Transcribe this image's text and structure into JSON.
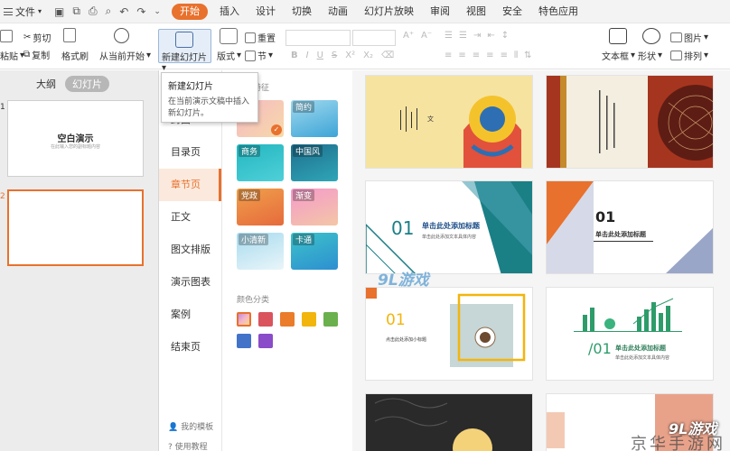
{
  "menubar": {
    "file_label": "文件",
    "tabs": [
      "开始",
      "插入",
      "设计",
      "切换",
      "动画",
      "幻灯片放映",
      "审阅",
      "视图",
      "安全",
      "特色应用"
    ],
    "active_tab": "开始"
  },
  "ribbon": {
    "paste": "粘贴",
    "cut": "剪切",
    "copy": "复制",
    "format_painter": "格式刷",
    "start_from_current": "从当前开始",
    "new_slide": "新建幻灯片",
    "layout": "版式",
    "reset": "重置",
    "section": "节",
    "textbox": "文本框",
    "shape": "形状",
    "picture": "图片",
    "arrange": "排列"
  },
  "tooltip": {
    "title": "新建幻灯片",
    "desc": "在当前演示文稿中插入新幻灯片。"
  },
  "left_panel": {
    "tabs": [
      "大纲",
      "幻灯片"
    ],
    "active_tab": "幻灯片",
    "slides": [
      {
        "num": "1",
        "title": "空白演示",
        "subtitle": "在此输入您的副标题内容"
      },
      {
        "num": "2"
      }
    ]
  },
  "categories": {
    "items": [
      "封面",
      "目录页",
      "章节页",
      "正文",
      "图文排版",
      "演示图表",
      "案例",
      "结束页"
    ],
    "active": "章节页",
    "footer": [
      "我的模板",
      "使用教程"
    ]
  },
  "styles": {
    "style_heading": "风格特征",
    "tiles": [
      "",
      "简约",
      "商务",
      "中国风",
      "党政",
      "渐变",
      "小清新",
      "卡通"
    ],
    "color_heading": "颜色分类",
    "colors": [
      "gradient",
      "#d9545d",
      "#ea7c2a",
      "#f2b50c",
      "#6ab04c",
      "#4273c9",
      "#8a4cc8"
    ]
  },
  "templates": [
    {
      "num": "",
      "title": "",
      "subtitle": ""
    },
    {
      "num": "",
      "title": "",
      "subtitle": ""
    },
    {
      "num": "01",
      "title": "单击此处添加标题",
      "subtitle": "单击此处添加文本具体内容"
    },
    {
      "num": "01",
      "title": "单击此处添加标题",
      "subtitle": ""
    },
    {
      "num": "01",
      "title": "点击此处添加小标题",
      "subtitle": ""
    },
    {
      "num": "/01",
      "title": "单击此处添加标题",
      "subtitle": "单击此处添加文本具体内容"
    }
  ],
  "watermarks": {
    "site": "9L游戏",
    "brand": "京华手游网"
  }
}
